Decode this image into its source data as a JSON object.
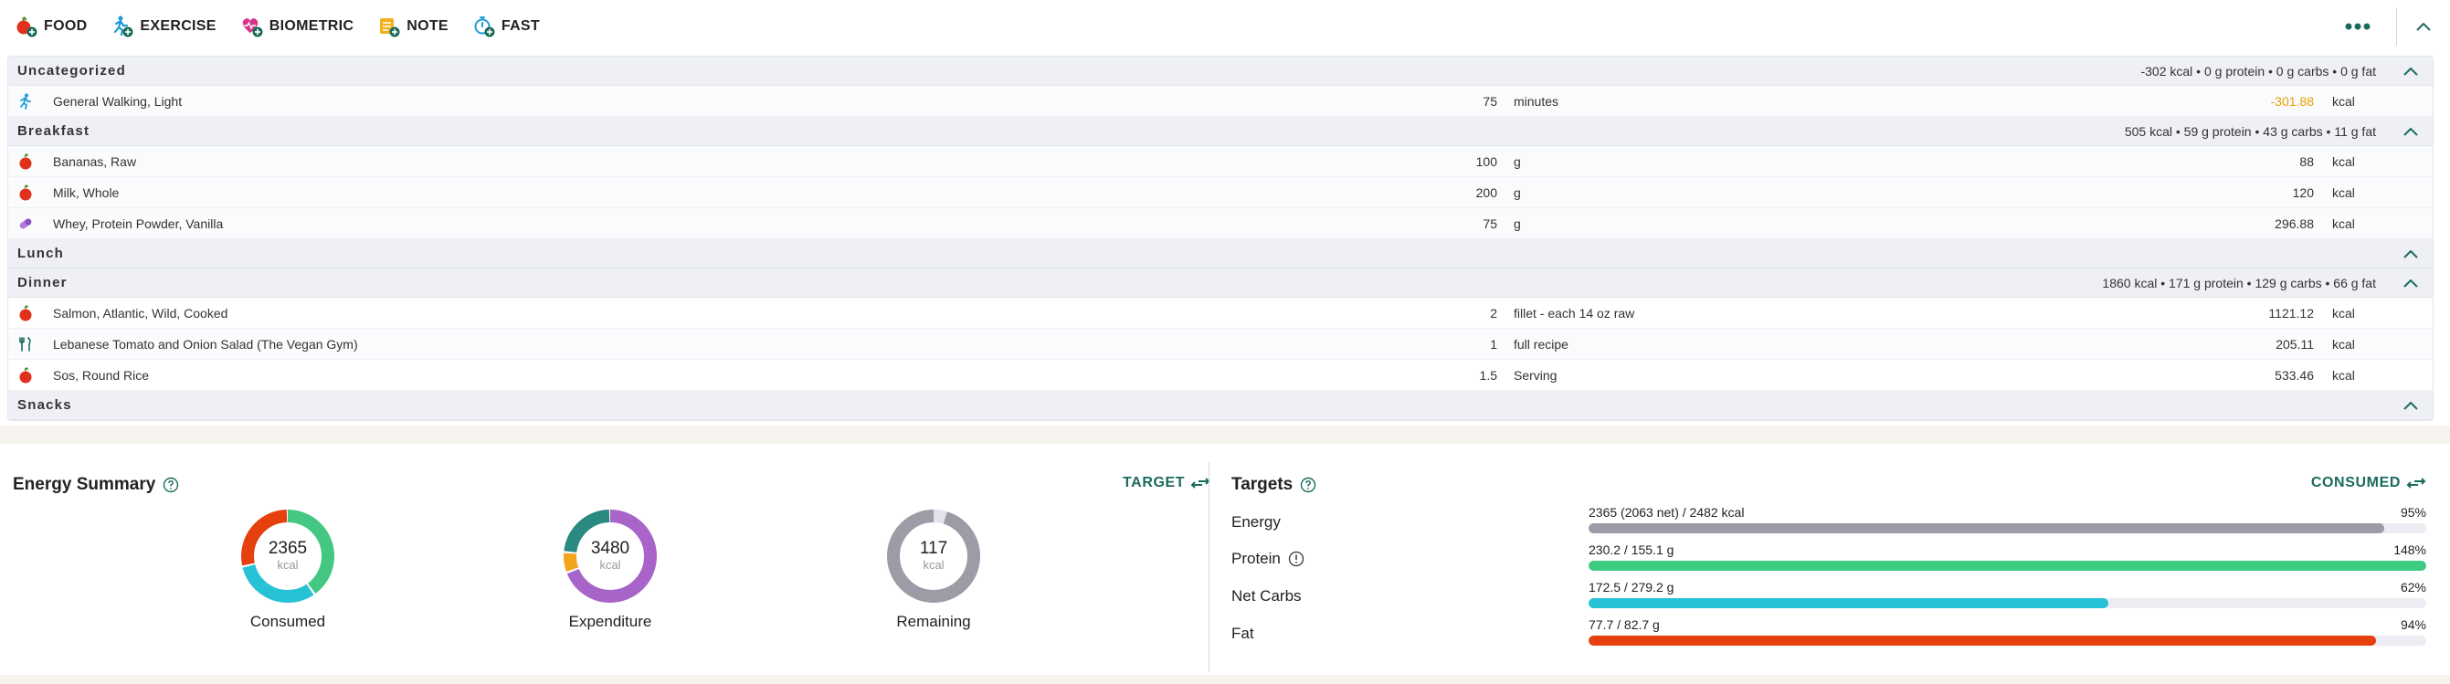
{
  "toolbar": {
    "items": [
      {
        "label": "FOOD",
        "icon": "apple-add-icon"
      },
      {
        "label": "EXERCISE",
        "icon": "runner-add-icon"
      },
      {
        "label": "BIOMETRIC",
        "icon": "heart-add-icon"
      },
      {
        "label": "NOTE",
        "icon": "note-add-icon"
      },
      {
        "label": "FAST",
        "icon": "stopwatch-add-icon"
      }
    ]
  },
  "diary": {
    "groups": [
      {
        "name": "Uncategorized",
        "summary": "-302 kcal • 0 g protein • 0 g carbs • 0 g fat",
        "items": [
          {
            "icon": "runner-icon",
            "name": "General Walking, Light",
            "amount": "75",
            "unit": "minutes",
            "value": "-301.88",
            "value_unit": "kcal"
          }
        ]
      },
      {
        "name": "Breakfast",
        "summary": "505 kcal • 59 g protein • 43 g carbs • 11 g fat",
        "items": [
          {
            "icon": "apple-icon",
            "name": "Bananas, Raw",
            "amount": "100",
            "unit": "g",
            "value": "88",
            "value_unit": "kcal"
          },
          {
            "icon": "apple-icon",
            "name": "Milk, Whole",
            "amount": "200",
            "unit": "g",
            "value": "120",
            "value_unit": "kcal"
          },
          {
            "icon": "supplement-icon",
            "name": "Whey, Protein Powder, Vanilla",
            "amount": "75",
            "unit": "g",
            "value": "296.88",
            "value_unit": "kcal"
          }
        ]
      },
      {
        "name": "Lunch",
        "summary": "",
        "items": []
      },
      {
        "name": "Dinner",
        "summary": "1860 kcal • 171 g protein • 129 g carbs • 66 g fat",
        "items": [
          {
            "icon": "apple-icon",
            "name": "Salmon, Atlantic, Wild, Cooked",
            "amount": "2",
            "unit": "fillet - each 14 oz raw",
            "value": "1121.12",
            "value_unit": "kcal"
          },
          {
            "icon": "recipe-icon",
            "name": "Lebanese Tomato and Onion Salad (The Vegan Gym)",
            "amount": "1",
            "unit": "full recipe",
            "value": "205.11",
            "value_unit": "kcal"
          },
          {
            "icon": "apple-icon",
            "name": "Sos, Round Rice",
            "amount": "1.5",
            "unit": "Serving",
            "value": "533.46",
            "value_unit": "kcal"
          }
        ]
      },
      {
        "name": "Snacks",
        "summary": "",
        "items": []
      }
    ]
  },
  "energy": {
    "title": "Energy Summary",
    "target_btn": "TARGET",
    "donuts": [
      {
        "value": "2365",
        "unit": "kcal",
        "label": "Consumed"
      },
      {
        "value": "3480",
        "unit": "kcal",
        "label": "Expenditure"
      },
      {
        "value": "117",
        "unit": "kcal",
        "label": "Remaining"
      }
    ]
  },
  "targets": {
    "title": "Targets",
    "consumed_btn": "CONSUMED",
    "rows": [
      {
        "name": "Energy",
        "text": "2365 (2063 net) / 2482 kcal",
        "pct": "95%",
        "fraction": 0.95,
        "color": "#9b9ca6"
      },
      {
        "name": "Protein",
        "text": "230.2 / 155.1 g",
        "pct": "148%",
        "fraction": 1.0,
        "color": "#3ccb7f"
      },
      {
        "name": "Net Carbs",
        "text": "172.5 / 279.2 g",
        "pct": "62%",
        "fraction": 0.62,
        "color": "#27c2d6"
      },
      {
        "name": "Fat",
        "text": "77.7 / 82.7 g",
        "pct": "94%",
        "fraction": 0.94,
        "color": "#e5400e"
      }
    ]
  },
  "colors": {
    "accent": "#1a6b5c",
    "negative": "#e8a000"
  }
}
